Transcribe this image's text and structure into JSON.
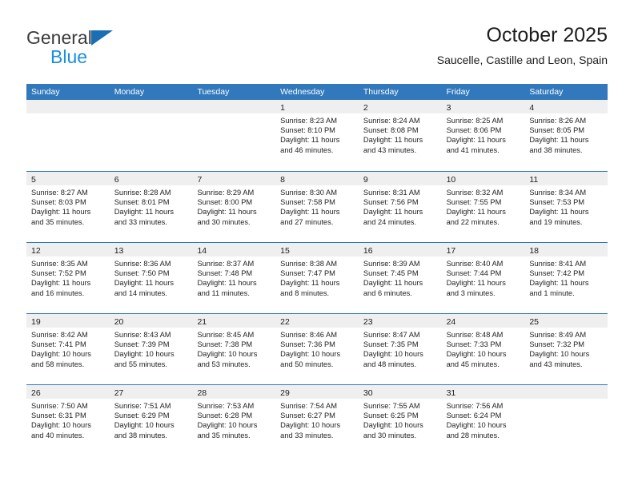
{
  "brand": {
    "name_top": "General",
    "name_bottom": "Blue",
    "triangle_color": "#1a6fb4",
    "text_color_top": "#3b3b3b",
    "text_color_bottom": "#1a8fe0"
  },
  "header": {
    "title": "October 2025",
    "subtitle": "Saucelle, Castille and Leon, Spain"
  },
  "theme": {
    "header_bg": "#3179bc",
    "header_text": "#ffffff",
    "day_band_bg": "#efefef",
    "row_divider": "#3179bc"
  },
  "weekdays": [
    "Sunday",
    "Monday",
    "Tuesday",
    "Wednesday",
    "Thursday",
    "Friday",
    "Saturday"
  ],
  "weeks": [
    [
      {
        "day": "",
        "lines": []
      },
      {
        "day": "",
        "lines": []
      },
      {
        "day": "",
        "lines": []
      },
      {
        "day": "1",
        "lines": [
          "Sunrise: 8:23 AM",
          "Sunset: 8:10 PM",
          "Daylight: 11 hours",
          "and 46 minutes."
        ]
      },
      {
        "day": "2",
        "lines": [
          "Sunrise: 8:24 AM",
          "Sunset: 8:08 PM",
          "Daylight: 11 hours",
          "and 43 minutes."
        ]
      },
      {
        "day": "3",
        "lines": [
          "Sunrise: 8:25 AM",
          "Sunset: 8:06 PM",
          "Daylight: 11 hours",
          "and 41 minutes."
        ]
      },
      {
        "day": "4",
        "lines": [
          "Sunrise: 8:26 AM",
          "Sunset: 8:05 PM",
          "Daylight: 11 hours",
          "and 38 minutes."
        ]
      }
    ],
    [
      {
        "day": "5",
        "lines": [
          "Sunrise: 8:27 AM",
          "Sunset: 8:03 PM",
          "Daylight: 11 hours",
          "and 35 minutes."
        ]
      },
      {
        "day": "6",
        "lines": [
          "Sunrise: 8:28 AM",
          "Sunset: 8:01 PM",
          "Daylight: 11 hours",
          "and 33 minutes."
        ]
      },
      {
        "day": "7",
        "lines": [
          "Sunrise: 8:29 AM",
          "Sunset: 8:00 PM",
          "Daylight: 11 hours",
          "and 30 minutes."
        ]
      },
      {
        "day": "8",
        "lines": [
          "Sunrise: 8:30 AM",
          "Sunset: 7:58 PM",
          "Daylight: 11 hours",
          "and 27 minutes."
        ]
      },
      {
        "day": "9",
        "lines": [
          "Sunrise: 8:31 AM",
          "Sunset: 7:56 PM",
          "Daylight: 11 hours",
          "and 24 minutes."
        ]
      },
      {
        "day": "10",
        "lines": [
          "Sunrise: 8:32 AM",
          "Sunset: 7:55 PM",
          "Daylight: 11 hours",
          "and 22 minutes."
        ]
      },
      {
        "day": "11",
        "lines": [
          "Sunrise: 8:34 AM",
          "Sunset: 7:53 PM",
          "Daylight: 11 hours",
          "and 19 minutes."
        ]
      }
    ],
    [
      {
        "day": "12",
        "lines": [
          "Sunrise: 8:35 AM",
          "Sunset: 7:52 PM",
          "Daylight: 11 hours",
          "and 16 minutes."
        ]
      },
      {
        "day": "13",
        "lines": [
          "Sunrise: 8:36 AM",
          "Sunset: 7:50 PM",
          "Daylight: 11 hours",
          "and 14 minutes."
        ]
      },
      {
        "day": "14",
        "lines": [
          "Sunrise: 8:37 AM",
          "Sunset: 7:48 PM",
          "Daylight: 11 hours",
          "and 11 minutes."
        ]
      },
      {
        "day": "15",
        "lines": [
          "Sunrise: 8:38 AM",
          "Sunset: 7:47 PM",
          "Daylight: 11 hours",
          "and 8 minutes."
        ]
      },
      {
        "day": "16",
        "lines": [
          "Sunrise: 8:39 AM",
          "Sunset: 7:45 PM",
          "Daylight: 11 hours",
          "and 6 minutes."
        ]
      },
      {
        "day": "17",
        "lines": [
          "Sunrise: 8:40 AM",
          "Sunset: 7:44 PM",
          "Daylight: 11 hours",
          "and 3 minutes."
        ]
      },
      {
        "day": "18",
        "lines": [
          "Sunrise: 8:41 AM",
          "Sunset: 7:42 PM",
          "Daylight: 11 hours",
          "and 1 minute."
        ]
      }
    ],
    [
      {
        "day": "19",
        "lines": [
          "Sunrise: 8:42 AM",
          "Sunset: 7:41 PM",
          "Daylight: 10 hours",
          "and 58 minutes."
        ]
      },
      {
        "day": "20",
        "lines": [
          "Sunrise: 8:43 AM",
          "Sunset: 7:39 PM",
          "Daylight: 10 hours",
          "and 55 minutes."
        ]
      },
      {
        "day": "21",
        "lines": [
          "Sunrise: 8:45 AM",
          "Sunset: 7:38 PM",
          "Daylight: 10 hours",
          "and 53 minutes."
        ]
      },
      {
        "day": "22",
        "lines": [
          "Sunrise: 8:46 AM",
          "Sunset: 7:36 PM",
          "Daylight: 10 hours",
          "and 50 minutes."
        ]
      },
      {
        "day": "23",
        "lines": [
          "Sunrise: 8:47 AM",
          "Sunset: 7:35 PM",
          "Daylight: 10 hours",
          "and 48 minutes."
        ]
      },
      {
        "day": "24",
        "lines": [
          "Sunrise: 8:48 AM",
          "Sunset: 7:33 PM",
          "Daylight: 10 hours",
          "and 45 minutes."
        ]
      },
      {
        "day": "25",
        "lines": [
          "Sunrise: 8:49 AM",
          "Sunset: 7:32 PM",
          "Daylight: 10 hours",
          "and 43 minutes."
        ]
      }
    ],
    [
      {
        "day": "26",
        "lines": [
          "Sunrise: 7:50 AM",
          "Sunset: 6:31 PM",
          "Daylight: 10 hours",
          "and 40 minutes."
        ]
      },
      {
        "day": "27",
        "lines": [
          "Sunrise: 7:51 AM",
          "Sunset: 6:29 PM",
          "Daylight: 10 hours",
          "and 38 minutes."
        ]
      },
      {
        "day": "28",
        "lines": [
          "Sunrise: 7:53 AM",
          "Sunset: 6:28 PM",
          "Daylight: 10 hours",
          "and 35 minutes."
        ]
      },
      {
        "day": "29",
        "lines": [
          "Sunrise: 7:54 AM",
          "Sunset: 6:27 PM",
          "Daylight: 10 hours",
          "and 33 minutes."
        ]
      },
      {
        "day": "30",
        "lines": [
          "Sunrise: 7:55 AM",
          "Sunset: 6:25 PM",
          "Daylight: 10 hours",
          "and 30 minutes."
        ]
      },
      {
        "day": "31",
        "lines": [
          "Sunrise: 7:56 AM",
          "Sunset: 6:24 PM",
          "Daylight: 10 hours",
          "and 28 minutes."
        ]
      },
      {
        "day": "",
        "lines": []
      }
    ]
  ]
}
